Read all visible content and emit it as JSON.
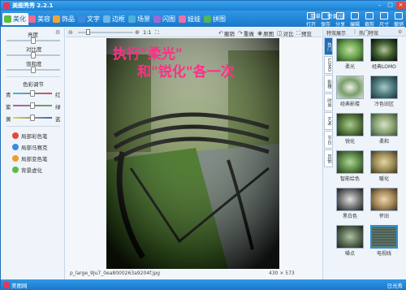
{
  "title": "美图秀秀 2.2.1",
  "window_controls": {
    "min": "–",
    "max": "□",
    "close": "×"
  },
  "tabs": [
    {
      "label": "美化",
      "icon": "palette-icon",
      "color": "#5dbb46"
    },
    {
      "label": "美容",
      "icon": "face-icon",
      "color": "#ef6a8f"
    },
    {
      "label": "饰品",
      "icon": "ornament-icon",
      "color": "#f1a33a"
    },
    {
      "label": "文字",
      "icon": "text-icon",
      "color": "#3c8be0"
    },
    {
      "label": "边框",
      "icon": "frame-icon",
      "color": "#6cb8e8"
    },
    {
      "label": "场景",
      "icon": "scene-icon",
      "color": "#4db1d6"
    },
    {
      "label": "闪图",
      "icon": "flash-icon",
      "color": "#9b6ad9"
    },
    {
      "label": "娃娃",
      "icon": "doll-icon",
      "color": "#f06ea9"
    },
    {
      "label": "拼图",
      "icon": "puzzle-icon",
      "color": "#52b55a"
    }
  ],
  "top_links": {
    "menu": "菜单",
    "login": "登录/注"
  },
  "toolbar": [
    {
      "label": "打开",
      "icon": "open-icon"
    },
    {
      "label": "保存",
      "icon": "save-icon"
    },
    {
      "label": "分享",
      "icon": "share-icon"
    },
    {
      "label": "编辑",
      "icon": "edit-icon"
    },
    {
      "label": "裁剪",
      "icon": "crop-icon"
    },
    {
      "label": "尺寸",
      "icon": "resize-icon"
    },
    {
      "label": "撤销",
      "icon": "undo-icon"
    }
  ],
  "left": {
    "brightness": "亮度",
    "contrast": "对比度",
    "saturation": "饱和度",
    "color_adjust": "色彩调节",
    "cyan": "青",
    "red": "红",
    "magenta": "紫",
    "green": "绿",
    "yellow": "黄",
    "blue": "蓝",
    "tools": [
      {
        "label": "局部彩色笔",
        "icon": "color-pen-icon",
        "color": "#e04a3a"
      },
      {
        "label": "局部马赛克",
        "icon": "mosaic-icon",
        "color": "#3c8be0"
      },
      {
        "label": "局部变色笔",
        "icon": "recolor-pen-icon",
        "color": "#f29b2a"
      },
      {
        "label": "背景虚化",
        "icon": "blur-icon",
        "color": "#5dbb46"
      }
    ]
  },
  "canvas": {
    "zoom_ratio": "1:1",
    "actions": [
      "撤销",
      "重做",
      "原图",
      "对比",
      "预览"
    ],
    "overlay_line1": "执行\"柔光\"",
    "overlay_line2": "和\"锐化\"各一次",
    "filename": "p_large_9Ju7_0ea8000263a9204f.jpg",
    "dimensions": "430 × 573"
  },
  "right": {
    "head_left": "特效展示",
    "head_right": "热门特效",
    "vtabs": [
      "热门",
      "LOMO",
      "影楼",
      "时尚",
      "艺术",
      "节日",
      "其他"
    ],
    "effects": [
      {
        "label": "柔光",
        "color": "#6aa64e"
      },
      {
        "label": "经典LOMO",
        "color": "#3d5a2e"
      },
      {
        "label": "经典影楼",
        "color": "#7b9e6c"
      },
      {
        "label": "冷色旧区",
        "color": "#4e7a7d"
      },
      {
        "label": "锐化",
        "color": "#5c7f43"
      },
      {
        "label": "柔和",
        "color": "#8aa475"
      },
      {
        "label": "智能绘色",
        "color": "#5f8c4c"
      },
      {
        "label": "暖化",
        "color": "#9e8f5a"
      },
      {
        "label": "黑白色",
        "color": "#7a7a7a"
      },
      {
        "label": "怀旧",
        "color": "#a88c5a"
      },
      {
        "label": "噪点",
        "color": "#5d6e55"
      },
      {
        "label": "电视线",
        "color": "#465a50"
      }
    ],
    "selected_effect": 11
  },
  "status": {
    "app": "美图网",
    "right": "日光秀"
  }
}
